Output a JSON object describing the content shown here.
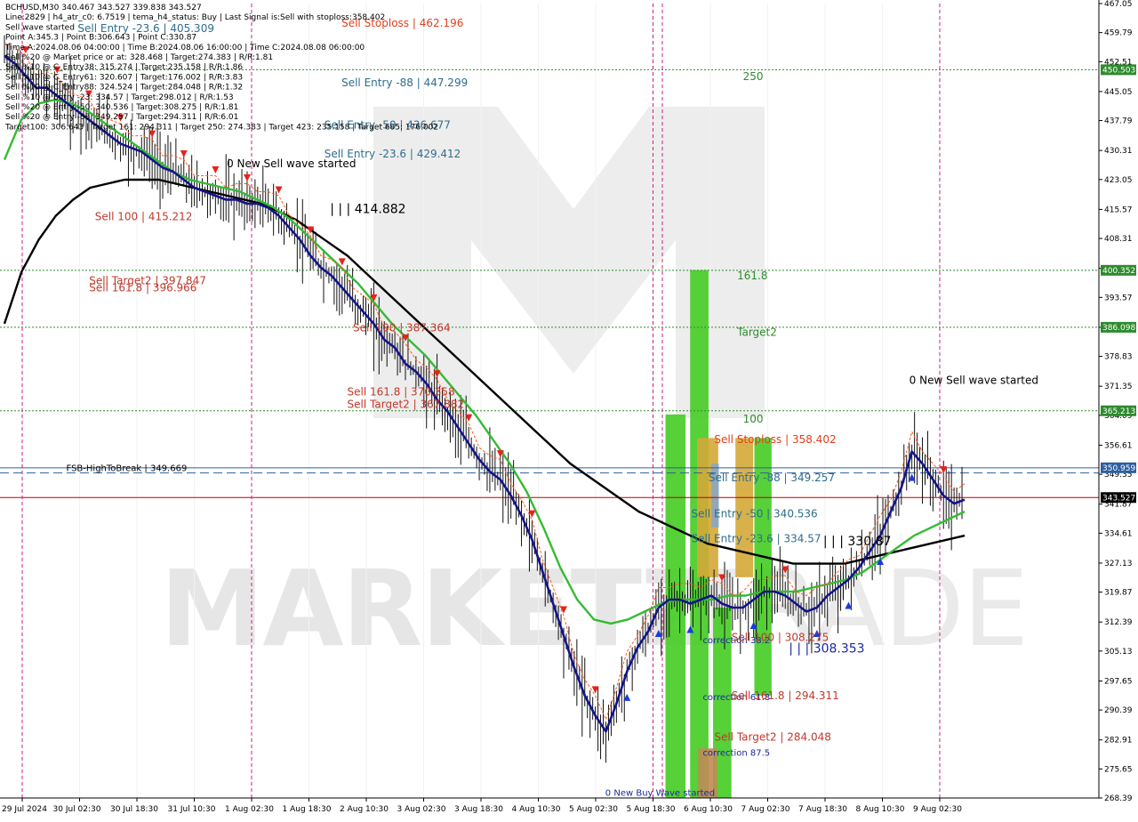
{
  "header": {
    "info_lines": [
      "BCHUSD,M30  340.467 343.527 339.838 343.527",
      "Line:2829 | h4_atr_c0: 6.7519 | tema_h4_status: Buy | Last Signal is:Sell with stoploss:358.402",
      "Sell wave started",
      "Point A:345.3 | Point B:306.643 | Point C:330.87",
      "Time A:2024.08.06 04:00:00 | Time B:2024.08.06 16:00:00 | Time C:2024.08.08 06:00:00",
      "Sell %20 @ Market price or at: 328.468 | Target:274.383 | R/R:1.81",
      "Sell %10 @ C_Entry38: 315.274 | Target:235.158 | R/R:1.86",
      "Sell %10 @ C_Entry61: 320.607 | Target:176.002 | R/R:3.83",
      "Sell %10 @ C_Entry88: 324.524 | Target:284.048 | R/R:1.32",
      "Sell %10 @ Entry -23: 334.57 | Target:298.012 | R/R:1.53",
      "Sell %20 @ Entry -50: 340.536 | Target:308.275 | R/R:1.81",
      "Sell %20 @ Entry -88: 349.257 | Target:294.311 | R/R:6.01",
      "Target100: 306.643 | Target 161: 294.311 | Target 250: 274.383 | Target 423: 235.158 | Target 685: 176.002"
    ]
  },
  "chart_data": {
    "type": "candlestick",
    "symbol": "BCHUSD",
    "timeframe": "M30",
    "ohlc": {
      "open": 340.467,
      "high": 343.527,
      "low": 339.838,
      "close": 343.527
    },
    "ylim": [
      268.39,
      467.05
    ],
    "y_ticks": [
      467.05,
      459.79,
      452.51,
      445.05,
      437.79,
      430.31,
      423.05,
      415.57,
      408.31,
      400.83,
      393.57,
      386.09,
      378.83,
      371.35,
      364.09,
      356.61,
      349.35,
      341.87,
      334.61,
      327.13,
      319.87,
      312.39,
      305.13,
      297.65,
      290.39,
      282.91,
      275.65,
      268.39
    ],
    "x_ticks": [
      "29 Jul 2024",
      "30 Jul 02:30",
      "30 Jul 18:30",
      "31 Jul 10:30",
      "1 Aug 02:30",
      "1 Aug 18:30",
      "2 Aug 10:30",
      "3 Aug 02:30",
      "3 Aug 18:30",
      "4 Aug 10:30",
      "5 Aug 02:30",
      "5 Aug 18:30",
      "6 Aug 10:30",
      "7 Aug 02:30",
      "7 Aug 18:30",
      "8 Aug 10:30",
      "9 Aug 02:30"
    ],
    "price_badges": [
      {
        "value": "450.503",
        "color": "#2e8b2e"
      },
      {
        "value": "400.352",
        "color": "#2e8b2e"
      },
      {
        "value": "386.098",
        "color": "#2e8b2e"
      },
      {
        "value": "365.213",
        "color": "#2e8b2e"
      },
      {
        "value": "350.959",
        "color": "#2e5fa0"
      },
      {
        "value": "343.527",
        "color": "#000000"
      }
    ],
    "hlines": [
      {
        "price": 450.503,
        "color": "#2e8b2e",
        "style": "dotted"
      },
      {
        "price": 400.352,
        "color": "#2e8b2e",
        "style": "dotted"
      },
      {
        "price": 386.098,
        "color": "#2e8b2e",
        "style": "dotted"
      },
      {
        "price": 365.213,
        "color": "#2e8b2e",
        "style": "dotted"
      },
      {
        "price": 349.669,
        "color": "#2e5fa0",
        "style": "dashed"
      },
      {
        "price": 350.959,
        "color": "#2e5fa0",
        "style": "solid"
      },
      {
        "price": 343.527,
        "color": "#c00000",
        "style": "solid"
      }
    ],
    "vlines_time": [
      "1 Aug 02:30",
      "5 Aug 18:30",
      "9 Aug 02:30"
    ],
    "annotations": [
      {
        "text": "Sell Entry -23.6 | 405.309",
        "color": "#2e6d8e",
        "price": 460.8,
        "time_idx": 1.2
      },
      {
        "text": "Sell Stoploss | 462.196",
        "color": "#e0401a",
        "price": 462.2,
        "time_idx": 5.8
      },
      {
        "text": "Sell Entry -88 | 447.299",
        "color": "#2e6d8e",
        "price": 447.3,
        "time_idx": 5.8
      },
      {
        "text": "Sell Entry -50 | 436.677",
        "color": "#2e6d8e",
        "price": 436.7,
        "time_idx": 5.5
      },
      {
        "text": "Sell Entry -23.6 | 429.412",
        "color": "#2e6d8e",
        "price": 429.4,
        "time_idx": 5.5
      },
      {
        "text": "0 New Sell wave started",
        "color": "#000000",
        "price": 427.0,
        "time_idx": 3.8
      },
      {
        "text": "| | | 414.882",
        "color": "#000000",
        "price": 415.6,
        "time_idx": 5.6,
        "big": true
      },
      {
        "text": "Sell 100 | 415.212",
        "color": "#c0392b",
        "price": 413.8,
        "time_idx": 1.5
      },
      {
        "text": "Sell Target2 | 397.847",
        "color": "#c0392b",
        "price": 397.8,
        "time_idx": 1.4
      },
      {
        "text": "Sell 161.8 | 396.966",
        "color": "#c0392b",
        "price": 396.0,
        "time_idx": 1.4
      },
      {
        "text": "Sell 100 | 387.364",
        "color": "#c0392b",
        "price": 386.0,
        "time_idx": 6.0
      },
      {
        "text": "Sell 161.8 | 370.358",
        "color": "#c0392b",
        "price": 370.0,
        "time_idx": 5.9
      },
      {
        "text": "Sell Target2 | 367.882",
        "color": "#c0392b",
        "price": 366.8,
        "time_idx": 5.9
      },
      {
        "text": "FSB-HighToBreak | 349.669",
        "color": "#000000",
        "price": 351.0,
        "time_idx": 1.0,
        "small": true
      },
      {
        "text": "250",
        "color": "#2e8b2e",
        "price": 448.8,
        "time_idx": 12.8
      },
      {
        "text": "161.8",
        "color": "#2e8b2e",
        "price": 399.0,
        "time_idx": 12.7
      },
      {
        "text": "Target2",
        "color": "#2e8b2e",
        "price": 384.9,
        "time_idx": 12.7
      },
      {
        "text": "100",
        "color": "#2e8b2e",
        "price": 363.2,
        "time_idx": 12.8
      },
      {
        "text": "Sell Stoploss | 358.402",
        "color": "#e0401a",
        "price": 358.0,
        "time_idx": 12.3
      },
      {
        "text": "Sell Entry -88 | 349.257",
        "color": "#2e6d8e",
        "price": 348.5,
        "time_idx": 12.2
      },
      {
        "text": "Sell Entry -50 | 340.536",
        "color": "#2e6d8e",
        "price": 339.5,
        "time_idx": 11.9
      },
      {
        "text": "Sell Entry -23.6 | 334.57",
        "color": "#2e6d8e",
        "price": 333.2,
        "time_idx": 11.9
      },
      {
        "text": "| | | 330.87",
        "color": "#000000",
        "price": 332.5,
        "time_idx": 14.2,
        "big": true
      },
      {
        "text": "correction 38.2",
        "color": "#1a2aa0",
        "price": 308.0,
        "time_idx": 12.1,
        "small": true
      },
      {
        "text": "Sell 100 | 308.275",
        "color": "#c0392b",
        "price": 308.6,
        "time_idx": 12.6
      },
      {
        "text": "| | | 308.353",
        "color": "#1a2aa0",
        "price": 305.6,
        "time_idx": 13.6,
        "big": true
      },
      {
        "text": "correction 61.8",
        "color": "#1a2aa0",
        "price": 293.8,
        "time_idx": 12.1,
        "small": true
      },
      {
        "text": "Sell 161.8 | 294.311",
        "color": "#c0392b",
        "price": 294.0,
        "time_idx": 12.6
      },
      {
        "text": "Sell Target2 | 284.048",
        "color": "#c0392b",
        "price": 283.6,
        "time_idx": 12.3
      },
      {
        "text": "correction 87.5",
        "color": "#1a2aa0",
        "price": 279.8,
        "time_idx": 12.1,
        "small": true
      },
      {
        "text": "0 New Buy Wave started",
        "color": "#1a2aa0",
        "price": 269.8,
        "time_idx": 10.4,
        "small": true
      },
      {
        "text": "0 New Sell wave started",
        "color": "#000000",
        "price": 372.8,
        "time_idx": 15.7
      }
    ],
    "zones": [
      {
        "color": "#44cc22",
        "t0": 11.45,
        "t1": 11.8,
        "p0": 268.39,
        "p1": 364.3
      },
      {
        "color": "#44cc22",
        "t0": 11.88,
        "t1": 12.2,
        "p0": 268.39,
        "p1": 400.4
      },
      {
        "color": "#44cc22",
        "t0": 12.28,
        "t1": 12.6,
        "p0": 268.39,
        "p1": 316.0
      },
      {
        "color": "#d4a837",
        "t0": 12.0,
        "t1": 12.37,
        "p0": 323.6,
        "p1": 358.4
      },
      {
        "color": "#8aa7c4",
        "t0": 12.25,
        "t1": 12.38,
        "p0": 336.0,
        "p1": 352.0
      },
      {
        "color": "#d4a837",
        "t0": 12.67,
        "t1": 12.98,
        "p0": 323.6,
        "p1": 358.4
      },
      {
        "color": "#44cc22",
        "t0": 13.0,
        "t1": 13.3,
        "p0": 294.0,
        "p1": 358.4
      },
      {
        "color": "#c08a55",
        "t0": 12.02,
        "t1": 12.35,
        "p0": 268.39,
        "p1": 280.8
      }
    ],
    "series_close": [
      454,
      452,
      449,
      446,
      446,
      444,
      442,
      440,
      438,
      436,
      434,
      432,
      431,
      430,
      428,
      426,
      425,
      423,
      421,
      420,
      419,
      418,
      418,
      417,
      417,
      416,
      414,
      411,
      408,
      404,
      401,
      399,
      396,
      393,
      390,
      387,
      383,
      381,
      377,
      375,
      372,
      368,
      365,
      361,
      357,
      353,
      350,
      348,
      344,
      339,
      333,
      325,
      317,
      309,
      301,
      294,
      289,
      285,
      292,
      300,
      306,
      310,
      316,
      318,
      318,
      317,
      318,
      319,
      317,
      316,
      316,
      318,
      320,
      320,
      319,
      317,
      315,
      316,
      319,
      321,
      323,
      326,
      330,
      334,
      340,
      346,
      355,
      352,
      348,
      344,
      342,
      343
    ],
    "ma_black": [
      387,
      400,
      408,
      414,
      418,
      421,
      422,
      423,
      423,
      423,
      422,
      421,
      420,
      419,
      418,
      417,
      415,
      413,
      410,
      407,
      404,
      400,
      396,
      392,
      388,
      384,
      380,
      376,
      372,
      368,
      364,
      360,
      356,
      352,
      349,
      346,
      343,
      340,
      338,
      336,
      334,
      332,
      331,
      330,
      329,
      328,
      327,
      327,
      327,
      327,
      328,
      329,
      330,
      331,
      332,
      333,
      334
    ],
    "ma_green": [
      428,
      438,
      442,
      443,
      442,
      440,
      437,
      434,
      431,
      428,
      425,
      423,
      422,
      421,
      420,
      418,
      416,
      413,
      409,
      405,
      401,
      397,
      392,
      387,
      383,
      379,
      374,
      369,
      364,
      358,
      352,
      345,
      336,
      326,
      318,
      313,
      312,
      313,
      315,
      317,
      318,
      318,
      318,
      319,
      319,
      320,
      320,
      320,
      321,
      322,
      323,
      325,
      328,
      331,
      334,
      336,
      338,
      340
    ]
  }
}
